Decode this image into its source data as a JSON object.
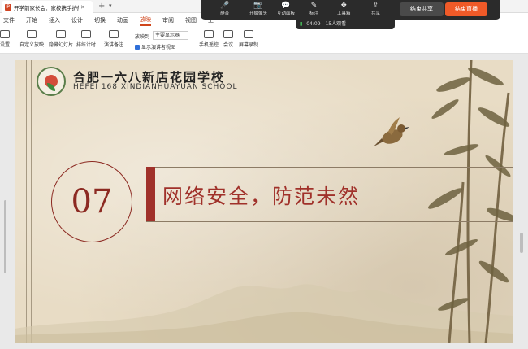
{
  "window": {
    "tab_title": "开学前家长会：家校携手护航",
    "tab_icon": "powerpoint-icon",
    "tab_close": "✕",
    "new_tab": "+"
  },
  "menus": [
    "文件",
    "开始",
    "插入",
    "设计",
    "切换",
    "动画",
    "放映",
    "审阅",
    "视图",
    "工"
  ],
  "active_menu_index": 6,
  "ribbon": {
    "items": [
      {
        "label": "设置",
        "icon": "settings-icon"
      },
      {
        "label": "自定义放映",
        "icon": "custom-show-icon"
      },
      {
        "label": "隐藏幻灯片",
        "icon": "hide-slide-icon"
      },
      {
        "label": "排练计时",
        "icon": "rehearse-timing-icon"
      },
      {
        "label": "演讲备注",
        "icon": "speaker-notes-icon"
      },
      {
        "label": "手机遥控",
        "icon": "phone-remote-icon"
      },
      {
        "label": "会议",
        "icon": "meeting-icon"
      },
      {
        "label": "屏幕录制",
        "icon": "screen-record-icon"
      }
    ],
    "display_label": "放映到",
    "display_select": "主要显示器",
    "presenter_view_label": "显示演讲者视图"
  },
  "meeting_toolbar": {
    "buttons": [
      {
        "label": "静音",
        "icon": "microphone-icon"
      },
      {
        "label": "开摄像头",
        "icon": "camera-off-icon"
      },
      {
        "label": "互动面板",
        "icon": "chat-panel-icon"
      },
      {
        "label": "标注",
        "icon": "pen-icon"
      },
      {
        "label": "工具箱",
        "icon": "toolbox-icon"
      },
      {
        "label": "共享",
        "icon": "share-icon"
      }
    ],
    "end_share_label": "结束共享",
    "end_live_label": "结束直播",
    "status_time": "04:09",
    "status_viewers": "15人观看",
    "accent_color": "#f05a28"
  },
  "slide": {
    "school_name_cn": "合肥一六八新店花园学校",
    "school_name_en": "HEFEI 168 XINDIANHUAYUAN SCHOOL",
    "section_number": "07",
    "section_title": "网络安全，防范未然",
    "accent_color": "#a0312a",
    "background_color": "#e8dcc5"
  }
}
